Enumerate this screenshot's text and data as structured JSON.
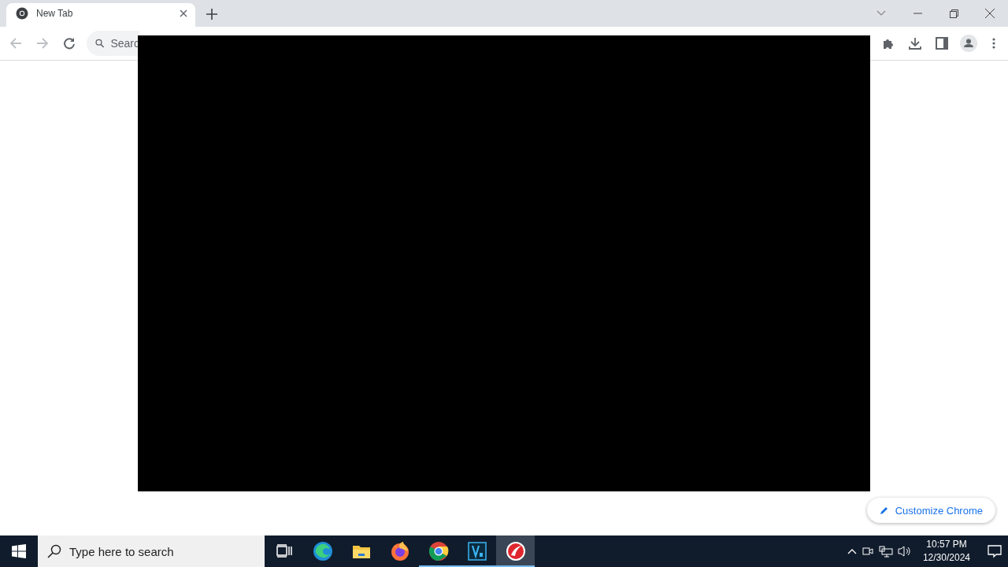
{
  "tab": {
    "title": "New Tab",
    "selected": true
  },
  "omnibox": {
    "placeholder": "Searc"
  },
  "customize_button": {
    "label": "Customize Chrome"
  },
  "taskbar": {
    "search": {
      "placeholder": "Type here to search"
    },
    "apps": [
      {
        "kind": "taskview",
        "running": false,
        "selected": false
      },
      {
        "kind": "edge",
        "running": false,
        "selected": false
      },
      {
        "kind": "explorer",
        "running": false,
        "selected": false
      },
      {
        "kind": "firefox",
        "running": false,
        "selected": false
      },
      {
        "kind": "chrome",
        "running": true,
        "selected": false
      },
      {
        "kind": "vapp",
        "running": true,
        "selected": false
      },
      {
        "kind": "redapp",
        "running": true,
        "selected": true
      }
    ],
    "clock": {
      "time": "10:57 PM",
      "date": "12/30/2024"
    }
  }
}
